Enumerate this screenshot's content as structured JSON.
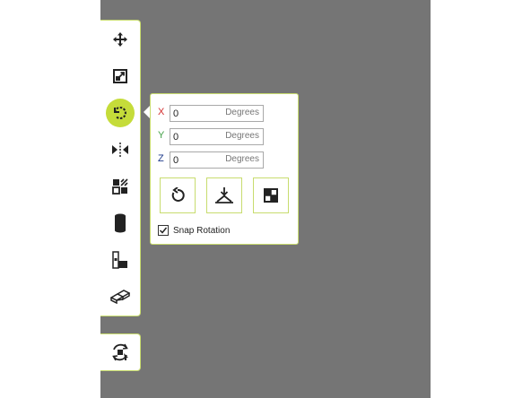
{
  "toolbar": {
    "tools": [
      {
        "icon": "move-icon"
      },
      {
        "icon": "scale-icon"
      },
      {
        "icon": "rotate-icon",
        "active": true
      },
      {
        "icon": "mirror-icon"
      },
      {
        "icon": "per-model-settings-icon"
      },
      {
        "icon": "support-blocker-icon"
      },
      {
        "icon": "custom-supports-icon"
      },
      {
        "icon": "mesh-tools-icon"
      }
    ],
    "extra_tool": {
      "icon": "auto-arrange-icon"
    }
  },
  "rotate_panel": {
    "x": {
      "label": "X",
      "value": "0",
      "unit": "Degrees",
      "color": "#d32f2f"
    },
    "y": {
      "label": "Y",
      "value": "0",
      "unit": "Degrees",
      "color": "#43a047"
    },
    "z": {
      "label": "Z",
      "value": "0",
      "unit": "Degrees",
      "color": "#1e3a8a"
    },
    "buttons": [
      {
        "icon": "reset-rotation-icon"
      },
      {
        "icon": "lay-flat-icon"
      },
      {
        "icon": "select-face-to-align-icon"
      }
    ],
    "snap": {
      "label": "Snap Rotation",
      "checked": true
    }
  },
  "colors": {
    "accent": "#c5dc3a",
    "border": "#c8dc6e",
    "viewport": "#757575"
  }
}
